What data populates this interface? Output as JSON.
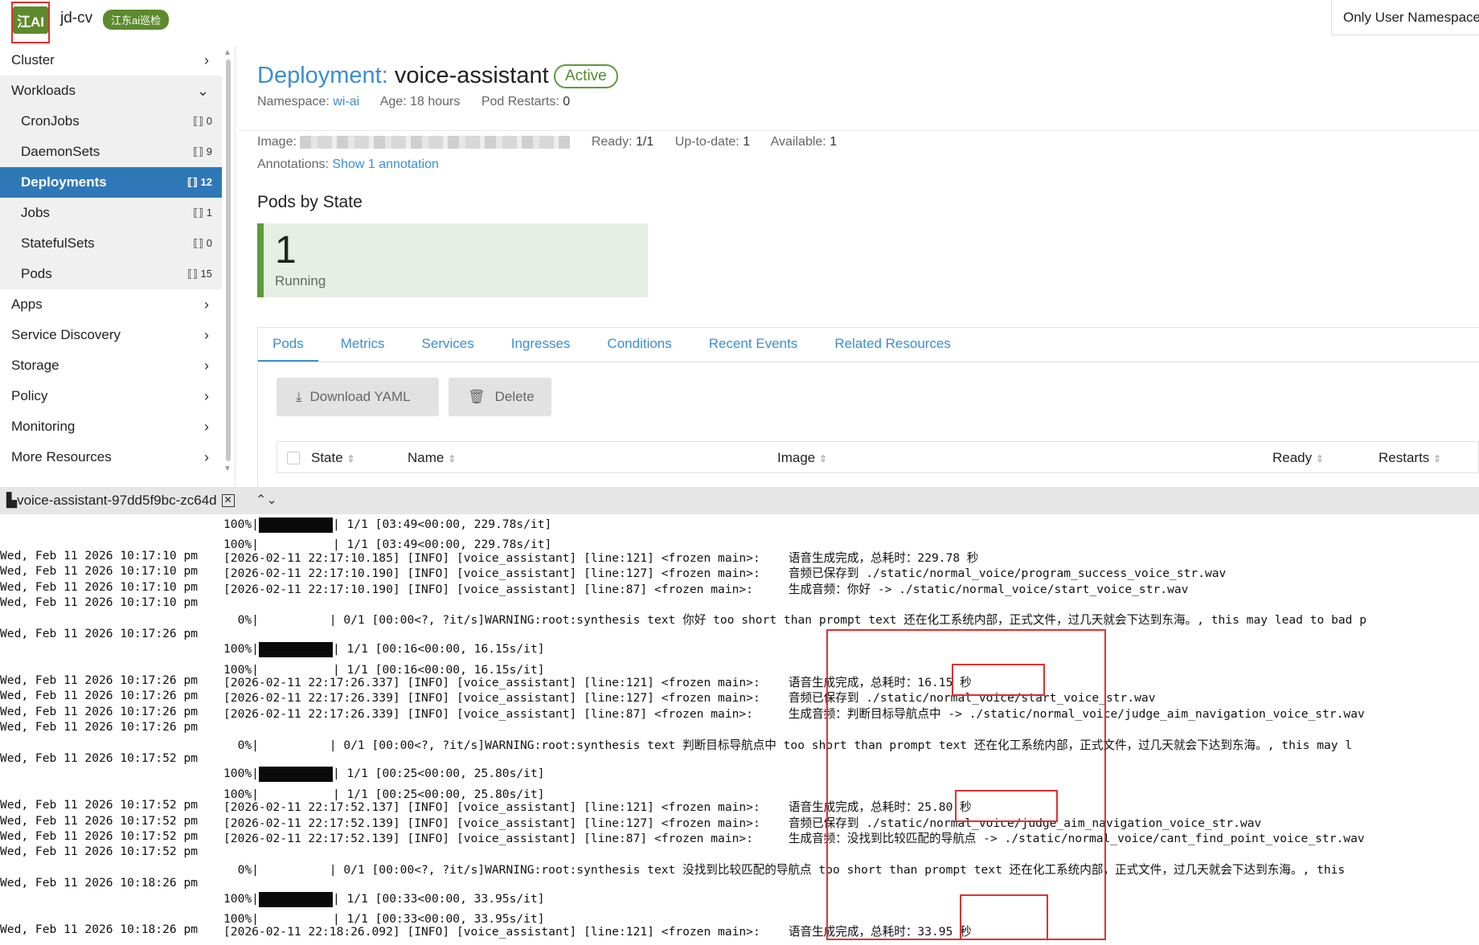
{
  "topbar": {
    "logo": "江AI",
    "cluster_name": "jd-cv",
    "cluster_badge": "江东ai巡检",
    "namespace_filter": "Only User Namespaces"
  },
  "sidebar": {
    "items": [
      {
        "label": "Cluster",
        "chev": "›"
      },
      {
        "label": "Workloads",
        "chev": "⌄"
      },
      {
        "label": "CronJobs",
        "count": "⟦⟧ 0"
      },
      {
        "label": "DaemonSets",
        "count": "⟦⟧ 9"
      },
      {
        "label": "Deployments",
        "count": "⟦⟧ 12"
      },
      {
        "label": "Jobs",
        "count": "⟦⟧ 1"
      },
      {
        "label": "StatefulSets",
        "count": "⟦⟧ 0"
      },
      {
        "label": "Pods",
        "count": "⟦⟧ 15"
      },
      {
        "label": "Apps",
        "chev": "›"
      },
      {
        "label": "Service Discovery",
        "chev": "›"
      },
      {
        "label": "Storage",
        "chev": "›"
      },
      {
        "label": "Policy",
        "chev": "›"
      },
      {
        "label": "Monitoring",
        "chev": "›"
      },
      {
        "label": "More Resources",
        "chev": "›"
      }
    ]
  },
  "header": {
    "kind": "Deployment:",
    "name": "voice-assistant",
    "status": "Active",
    "namespace_label": "Namespace:",
    "namespace": "wi-ai",
    "age_label": "Age:",
    "age": "18 hours",
    "restarts_label": "Pod Restarts:",
    "restarts": "0",
    "image_label": "Image:",
    "ready_label": "Ready:",
    "ready": "1/1",
    "uptodate_label": "Up-to-date:",
    "uptodate": "1",
    "available_label": "Available:",
    "available": "1",
    "annotations_label": "Annotations:",
    "annotations_link": "Show 1 annotation"
  },
  "pods_by_state": {
    "title": "Pods by State",
    "count": "1",
    "state": "Running"
  },
  "tabs": [
    "Pods",
    "Metrics",
    "Services",
    "Ingresses",
    "Conditions",
    "Recent Events",
    "Related Resources"
  ],
  "actions": {
    "download": "Download YAML",
    "delete": "Delete"
  },
  "table": {
    "headers": [
      "State",
      "Name",
      "Image",
      "Ready",
      "Restarts"
    ]
  },
  "terminal": {
    "tab_label": "voice-assistant-97dd5f9bc-zc64d",
    "lines": [
      {
        "ts": "",
        "msg": "100%|",
        "bar": true,
        "tail": "| 1/1 [03:49<00:00, 229.78s/it]"
      },
      {
        "ts": "",
        "msg": "100%|",
        "bar": false,
        "tail": "| 1/1 [03:49<00:00, 229.78s/it]"
      },
      {
        "ts": "Wed, Feb 11 2026 10:17:10 pm",
        "msg": "[2026-02-11 22:17:10.185] [INFO] [voice_assistant] [line:121] <frozen main>:    语音生成完成，总耗时：229.78 秒"
      },
      {
        "ts": "Wed, Feb 11 2026 10:17:10 pm",
        "msg": "[2026-02-11 22:17:10.190] [INFO] [voice_assistant] [line:127] <frozen main>:    音频已保存到 ./static/normal_voice/program_success_voice_str.wav"
      },
      {
        "ts": "Wed, Feb 11 2026 10:17:10 pm",
        "msg": "[2026-02-11 22:17:10.190] [INFO] [voice_assistant] [line:87] <frozen main>:     生成音频：你好 -> ./static/normal_voice/start_voice_str.wav"
      },
      {
        "ts": "Wed, Feb 11 2026 10:17:10 pm",
        "msg": ""
      },
      {
        "ts": "",
        "msg": "  0%|          | 0/1 [00:00<?, ?it/s]WARNING:root:synthesis text 你好 too short than prompt text 还在化工系统内部，正式文件，过几天就会下达到东海。, this may lead to bad p"
      },
      {
        "ts": "Wed, Feb 11 2026 10:17:26 pm",
        "msg": ""
      },
      {
        "ts": "",
        "msg": "100%|",
        "bar": true,
        "tail": "| 1/1 [00:16<00:00, 16.15s/it]"
      },
      {
        "ts": "",
        "msg": "100%|",
        "bar": false,
        "tail": "| 1/1 [00:16<00:00, 16.15s/it]"
      },
      {
        "ts": "Wed, Feb 11 2026 10:17:26 pm",
        "msg": "[2026-02-11 22:17:26.337] [INFO] [voice_assistant] [line:121] <frozen main>:    语音生成完成，总耗时：16.15 秒"
      },
      {
        "ts": "Wed, Feb 11 2026 10:17:26 pm",
        "msg": "[2026-02-11 22:17:26.339] [INFO] [voice_assistant] [line:127] <frozen main>:    音频已保存到 ./static/normal_voice/start_voice_str.wav"
      },
      {
        "ts": "Wed, Feb 11 2026 10:17:26 pm",
        "msg": "[2026-02-11 22:17:26.339] [INFO] [voice_assistant] [line:87] <frozen main>:     生成音频：判断目标导航点中 -> ./static/normal_voice/judge_aim_navigation_voice_str.wav"
      },
      {
        "ts": "Wed, Feb 11 2026 10:17:26 pm",
        "msg": ""
      },
      {
        "ts": "",
        "msg": "  0%|          | 0/1 [00:00<?, ?it/s]WARNING:root:synthesis text 判断目标导航点中 too short than prompt text 还在化工系统内部，正式文件，过几天就会下达到东海。, this may l"
      },
      {
        "ts": "Wed, Feb 11 2026 10:17:52 pm",
        "msg": ""
      },
      {
        "ts": "",
        "msg": "100%|",
        "bar": true,
        "tail": "| 1/1 [00:25<00:00, 25.80s/it]"
      },
      {
        "ts": "",
        "msg": "100%|",
        "bar": false,
        "tail": "| 1/1 [00:25<00:00, 25.80s/it]"
      },
      {
        "ts": "Wed, Feb 11 2026 10:17:52 pm",
        "msg": "[2026-02-11 22:17:52.137] [INFO] [voice_assistant] [line:121] <frozen main>:    语音生成完成，总耗时：25.80 秒"
      },
      {
        "ts": "Wed, Feb 11 2026 10:17:52 pm",
        "msg": "[2026-02-11 22:17:52.139] [INFO] [voice_assistant] [line:127] <frozen main>:    音频已保存到 ./static/normal_voice/judge_aim_navigation_voice_str.wav"
      },
      {
        "ts": "Wed, Feb 11 2026 10:17:52 pm",
        "msg": "[2026-02-11 22:17:52.139] [INFO] [voice_assistant] [line:87] <frozen main>:     生成音频：没找到比较匹配的导航点 -> ./static/normal_voice/cant_find_point_voice_str.wav"
      },
      {
        "ts": "Wed, Feb 11 2026 10:17:52 pm",
        "msg": ""
      },
      {
        "ts": "",
        "msg": "  0%|          | 0/1 [00:00<?, ?it/s]WARNING:root:synthesis text 没找到比较匹配的导航点 too short than prompt text 还在化工系统内部，正式文件，过几天就会下达到东海。, this"
      },
      {
        "ts": "Wed, Feb 11 2026 10:18:26 pm",
        "msg": ""
      },
      {
        "ts": "",
        "msg": "100%|",
        "bar": true,
        "tail": "| 1/1 [00:33<00:00, 33.95s/it]"
      },
      {
        "ts": "",
        "msg": "100%|",
        "bar": false,
        "tail": "| 1/1 [00:33<00:00, 33.95s/it]"
      },
      {
        "ts": "Wed, Feb 11 2026 10:18:26 pm",
        "msg": "[2026-02-11 22:18:26.092] [INFO] [voice_assistant] [line:121] <frozen main>:    语音生成完成，总耗时：33.95 秒"
      }
    ]
  },
  "colors": {
    "accent": "#3b8ed2",
    "active_nav": "#2f78b7",
    "brand_green": "#5d8a2c",
    "annotation_red": "#e03030"
  }
}
